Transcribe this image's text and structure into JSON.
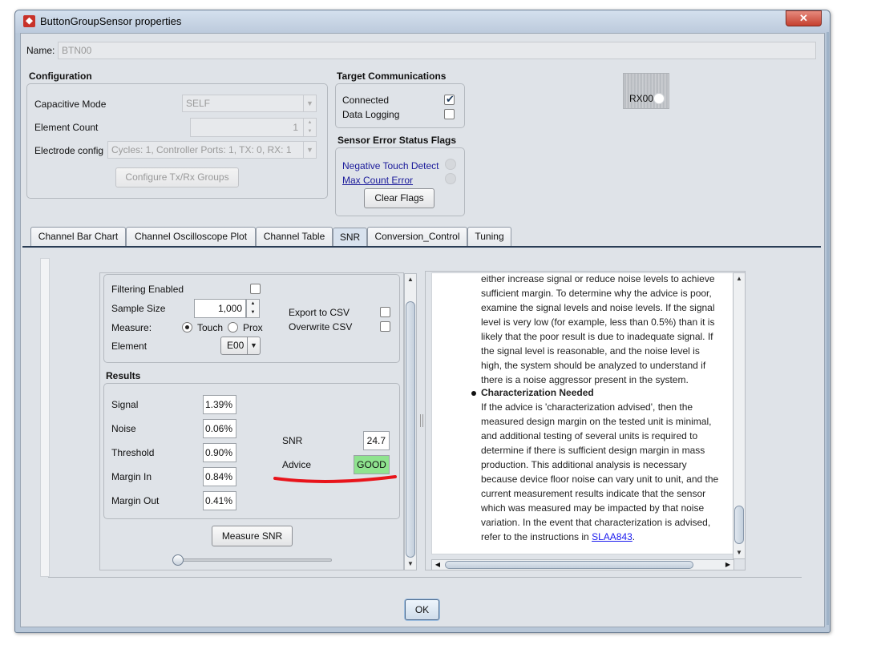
{
  "window": {
    "title": "ButtonGroupSensor properties",
    "close_glyph": "✕",
    "app_icon_glyph": "◆"
  },
  "name_row": {
    "label": "Name:",
    "value": "BTN00"
  },
  "configuration": {
    "title": "Configuration",
    "capacitive_mode": {
      "label": "Capacitive Mode",
      "value": "SELF"
    },
    "element_count": {
      "label": "Element Count",
      "value": "1"
    },
    "electrode_config": {
      "label": "Electrode config",
      "value": "Cycles: 1, Controller Ports: 1, TX: 0, RX: 1"
    },
    "configure_button": "Configure Tx/Rx Groups"
  },
  "target_communications": {
    "title": "Target Communications",
    "connected": {
      "label": "Connected",
      "checked": true
    },
    "data_logging": {
      "label": "Data Logging",
      "checked": false
    }
  },
  "sensor_error_flags": {
    "title": "Sensor Error Status Flags",
    "negative_touch": "Negative Touch Detect",
    "max_count": "Max Count Error",
    "clear_button": "Clear Flags"
  },
  "rx_widget": {
    "label": "RX00"
  },
  "tabs": [
    {
      "label": "Channel Bar Chart",
      "active": false
    },
    {
      "label": "Channel Oscilloscope Plot",
      "active": false
    },
    {
      "label": "Channel Table",
      "active": false
    },
    {
      "label": "SNR",
      "active": true
    },
    {
      "label": "Conversion_Control",
      "active": false
    },
    {
      "label": "Tuning",
      "active": false
    }
  ],
  "snr_settings": {
    "filtering_enabled": {
      "label": "Filtering Enabled",
      "checked": false
    },
    "sample_size": {
      "label": "Sample Size",
      "value": "1,000"
    },
    "measure": {
      "label": "Measure:",
      "option_touch": "Touch",
      "option_prox": "Prox",
      "selected": "Touch"
    },
    "element": {
      "label": "Element",
      "value": "E00"
    },
    "export_csv": {
      "label": "Export to CSV",
      "checked": false
    },
    "overwrite_csv": {
      "label": "Overwrite CSV",
      "checked": false
    }
  },
  "results": {
    "title": "Results",
    "signal": {
      "label": "Signal",
      "value": "1.39%"
    },
    "noise": {
      "label": "Noise",
      "value": "0.06%"
    },
    "threshold": {
      "label": "Threshold",
      "value": "0.90%"
    },
    "margin_in": {
      "label": "Margin In",
      "value": "0.84%"
    },
    "margin_out": {
      "label": "Margin Out",
      "value": "0.41%"
    },
    "snr": {
      "label": "SNR",
      "value": "24.7"
    },
    "advice": {
      "label": "Advice",
      "value": "GOOD"
    },
    "measure_button": "Measure SNR",
    "annotation_color": "#e8141b",
    "good_color": "#8fe38f"
  },
  "help": {
    "lines_top": [
      "either increase signal or reduce noise levels to achieve",
      "sufficient margin. To determine why the advice is poor,",
      "examine the signal levels and noise levels. If the signal",
      "level is very low (for example, less than 0.5%) than it is",
      "likely that the poor result is due to inadequate signal. If",
      "the signal level is reasonable, and the noise level is",
      "high, the system should be analyzed to understand if",
      "there is a noise aggressor present in the system."
    ],
    "heading": "Characterization Needed",
    "lines_bottom": [
      "If the advice is 'characterization advised', then the",
      "measured design margin on the tested unit is minimal,",
      "and additional testing of several units is required to",
      "determine if there is sufficient design margin in mass",
      "production. This additional analysis is necessary",
      "because device floor noise can vary unit to unit, and the",
      "current measurement results indicate that the sensor",
      "which was measured may be impacted by that noise",
      "variation. In the event that characterization is advised,"
    ],
    "last_line_prefix": "refer to the instructions in ",
    "link_text": "SLAA843",
    "last_line_suffix": "."
  },
  "scroll_glyphs": {
    "up": "▲",
    "down": "▼",
    "left": "◀",
    "right": "▶"
  },
  "footer": {
    "ok_button": "OK"
  }
}
